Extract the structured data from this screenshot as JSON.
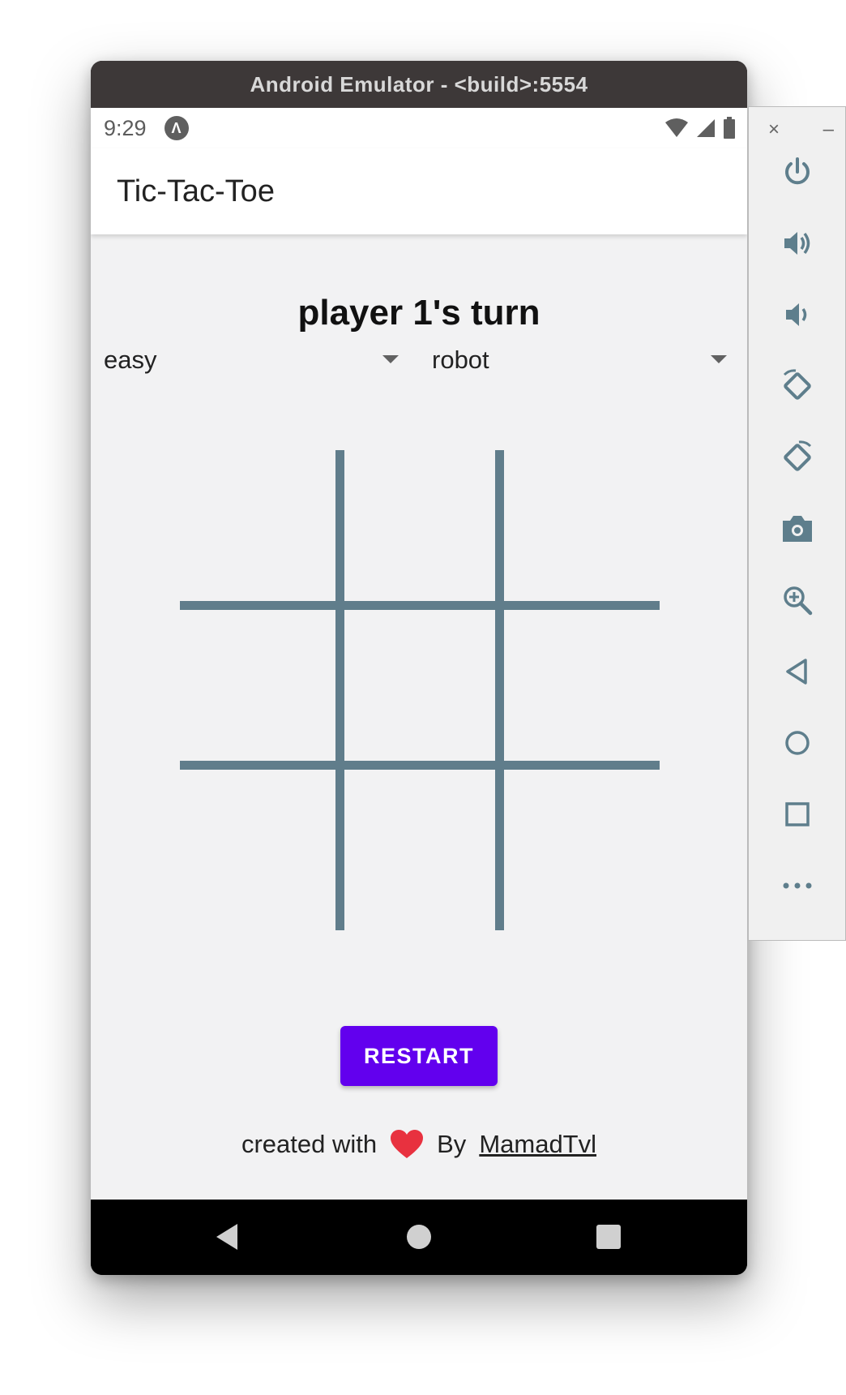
{
  "window": {
    "title": "Android Emulator - <build>:5554"
  },
  "status_bar": {
    "time": "9:29",
    "app_indicator": "Λ",
    "icons": [
      "wifi-icon",
      "signal-icon",
      "battery-icon"
    ]
  },
  "app_bar": {
    "title": "Tic-Tac-Toe"
  },
  "game": {
    "turn_text": "player 1's turn",
    "difficulty": "easy",
    "opponent": "robot",
    "board": [
      "",
      "",
      "",
      "",
      "",
      "",
      "",
      "",
      ""
    ],
    "grid_color": "#607d8b"
  },
  "restart_button": {
    "label": "RESTART",
    "color": "#6200ee"
  },
  "footer": {
    "prefix": "created with",
    "heart_icon": "heart-icon",
    "by": "By",
    "author": "MamadTvl",
    "heart_color": "#e8313f"
  },
  "nav_bar": {
    "buttons": [
      "back-icon",
      "home-icon",
      "recents-icon"
    ]
  },
  "emulator_panel": {
    "close": "×",
    "minimize": "–",
    "buttons": [
      "power-icon",
      "volume-up-icon",
      "volume-down-icon",
      "rotate-left-icon",
      "rotate-right-icon",
      "camera-icon",
      "zoom-icon",
      "back-icon",
      "home-icon",
      "overview-icon",
      "more-icon"
    ]
  }
}
